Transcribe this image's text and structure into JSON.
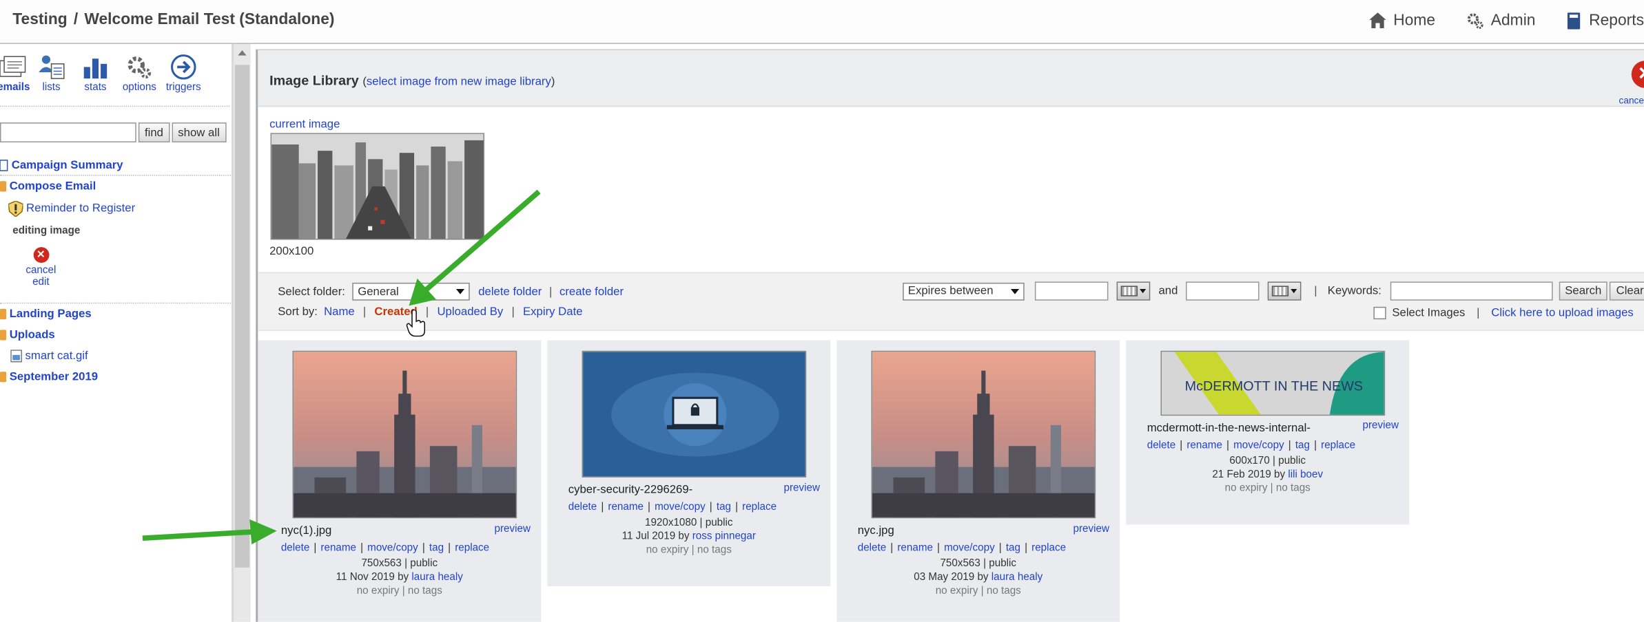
{
  "header": {
    "crumb_parent": "Testing",
    "crumb_sep": "/",
    "crumb_title": "Welcome Email Test (Standalone)",
    "nav": [
      {
        "label": "Home",
        "icon": "home-icon"
      },
      {
        "label": "Admin",
        "icon": "gear-icon"
      },
      {
        "label": "Reports",
        "icon": "book-icon"
      }
    ]
  },
  "sidebar": {
    "tools": [
      {
        "label": "emails",
        "icon": "emails-icon"
      },
      {
        "label": "lists",
        "icon": "lists-icon"
      },
      {
        "label": "stats",
        "icon": "stats-icon"
      },
      {
        "label": "options",
        "icon": "options-icon"
      },
      {
        "label": "triggers",
        "icon": "triggers-icon"
      }
    ],
    "find_label": "find",
    "showall_label": "show all",
    "tree": {
      "campaign_summary": "Campaign Summary",
      "compose_email": "Compose Email",
      "reminder": "Reminder to Register",
      "editing": "editing image",
      "cancel_edit_1": "cancel",
      "cancel_edit_2": "edit",
      "landing_pages": "Landing Pages",
      "uploads": "Uploads",
      "upload_file": "smart cat.gif",
      "september": "September 2019"
    }
  },
  "library": {
    "title": "Image Library",
    "subtitle_open": "(",
    "subtitle_link": "select image from new image library",
    "subtitle_close": ")",
    "cancel_label": "cancel",
    "current_image_label": "current image",
    "current_image_size": "200x100"
  },
  "filters": {
    "select_folder_label": "Select folder:",
    "folder_value": "General",
    "delete_folder": "delete folder",
    "create_folder": "create folder",
    "sort_label": "Sort by:",
    "sort_options": [
      "Name",
      "Created",
      "Uploaded By",
      "Expiry Date"
    ],
    "sort_active": "Created",
    "expiry_value": "Expires between",
    "and_label": "and",
    "keywords_label": "Keywords:",
    "search_label": "Search",
    "clear_label": "Clear",
    "select_images_label": "Select Images",
    "upload_link": "Click here to upload images",
    "sep": "|"
  },
  "images": [
    {
      "name": "nyc(1).jpg",
      "preview": "preview",
      "actions": [
        "delete",
        "rename",
        "move/copy",
        "tag",
        "replace"
      ],
      "dims": "750x563",
      "visibility": "public",
      "date": "11 Nov 2019 by",
      "user": "laura healy",
      "expiry": "no expiry",
      "tags": "no tags",
      "sep": "|"
    },
    {
      "name": "cyber-security-2296269-",
      "preview": "preview",
      "actions": [
        "delete",
        "rename",
        "move/copy",
        "tag",
        "replace"
      ],
      "dims": "1920x1080",
      "visibility": "public",
      "date": "11 Jul 2019 by",
      "user": "ross pinnegar",
      "expiry": "no expiry",
      "tags": "no tags",
      "sep": "|"
    },
    {
      "name": "nyc.jpg",
      "preview": "preview",
      "actions": [
        "delete",
        "rename",
        "move/copy",
        "tag",
        "replace"
      ],
      "dims": "750x563",
      "visibility": "public",
      "date": "03 May 2019 by",
      "user": "laura healy",
      "expiry": "no expiry",
      "tags": "no tags",
      "sep": "|"
    },
    {
      "name": "mcdermott-in-the-news-internal-",
      "preview": "preview",
      "actions": [
        "delete",
        "rename",
        "move/copy",
        "tag",
        "replace"
      ],
      "dims": "600x170",
      "visibility": "public",
      "date": "21 Feb 2019 by",
      "user": "lili boev",
      "expiry": "no expiry",
      "tags": "no tags",
      "sep": "|",
      "banner_text": "McDERMOTT IN THE NEWS"
    }
  ],
  "colors": {
    "accent": "#2244cc",
    "active_sort": "#cc3300",
    "arrow": "#3aac2c",
    "cancel": "#d0281c",
    "folder": "#e9a23b"
  }
}
